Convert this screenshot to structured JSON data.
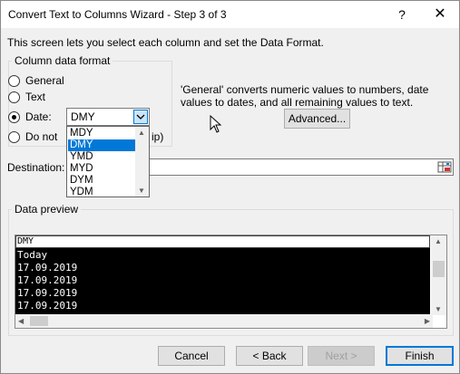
{
  "window": {
    "title": "Convert Text to Columns Wizard - Step 3 of 3",
    "help": "?",
    "close": "✕"
  },
  "intro": "This screen lets you select each column and set the Data Format.",
  "format": {
    "group_label": "Column data format",
    "options": [
      {
        "label": "General",
        "checked": false
      },
      {
        "label": "Text",
        "checked": false
      },
      {
        "label": "Date:",
        "checked": true
      },
      {
        "label": "Do not",
        "checked": false
      }
    ],
    "skip_suffix": "ip)",
    "date_value": "DMY",
    "date_options": [
      "MDY",
      "DMY",
      "YMD",
      "MYD",
      "DYM",
      "YDM"
    ],
    "date_selected": "DMY"
  },
  "description": "'General' converts numeric values to numbers, date values to dates, and all remaining values to text.",
  "advanced_button": "Advanced...",
  "destination": {
    "label": "Destination:",
    "value": ""
  },
  "preview": {
    "group_label": "Data preview",
    "header": "DMY",
    "rows": [
      "Today",
      "17.09.2019",
      "17.09.2019",
      "17.09.2019",
      "17.09.2019"
    ]
  },
  "buttons": {
    "cancel": "Cancel",
    "back": "< Back",
    "next": "Next >",
    "finish": "Finish"
  },
  "colors": {
    "accent": "#0078d7",
    "selection": "#0078d7",
    "preview_bg": "#000000"
  }
}
